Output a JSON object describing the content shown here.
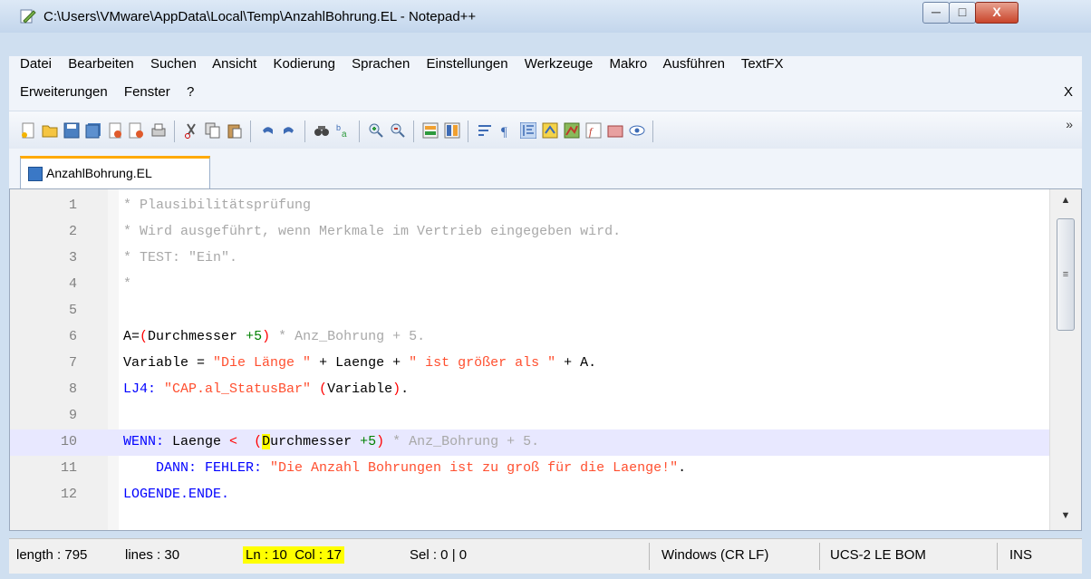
{
  "window": {
    "title": "C:\\Users\\VMware\\AppData\\Local\\Temp\\AnzahlBohrung.EL - Notepad++",
    "minimize_glyph": "─",
    "maximize_glyph": "□",
    "close_glyph": "X"
  },
  "menu": {
    "row1": [
      "Datei",
      "Bearbeiten",
      "Suchen",
      "Ansicht",
      "Kodierung",
      "Sprachen",
      "Einstellungen",
      "Werkzeuge",
      "Makro",
      "Ausführen",
      "TextFX"
    ],
    "row2": [
      "Erweiterungen",
      "Fenster",
      "?"
    ],
    "close_doc": "X"
  },
  "toolbar": {
    "more_glyph": "»"
  },
  "tabs": [
    {
      "label": "AnzahlBohrung.EL",
      "active": true
    }
  ],
  "editor": {
    "current_line": 10,
    "lines": [
      {
        "n": "1",
        "segs": [
          {
            "t": "* Plausibilitätsprüfung",
            "c": "comment"
          }
        ]
      },
      {
        "n": "2",
        "segs": [
          {
            "t": "* Wird ausgeführt, wenn Merkmale im Vertrieb eingegeben wird.",
            "c": "comment"
          }
        ]
      },
      {
        "n": "3",
        "segs": [
          {
            "t": "* TEST: \"Ein\".",
            "c": "comment"
          }
        ]
      },
      {
        "n": "4",
        "segs": [
          {
            "t": "*",
            "c": "comment"
          }
        ]
      },
      {
        "n": "5",
        "segs": []
      },
      {
        "n": "6",
        "segs": [
          {
            "t": "A=",
            "c": ""
          },
          {
            "t": "(",
            "c": "brace"
          },
          {
            "t": "Durchmesser ",
            "c": ""
          },
          {
            "t": "+5",
            "c": "num"
          },
          {
            "t": ")",
            "c": "brace"
          },
          {
            "t": " * Anz_Bohrung + 5.",
            "c": "comment"
          }
        ]
      },
      {
        "n": "7",
        "segs": [
          {
            "t": "Variable = ",
            "c": ""
          },
          {
            "t": "\"Die Länge \"",
            "c": "str"
          },
          {
            "t": " + Laenge + ",
            "c": ""
          },
          {
            "t": "\" ist größer als \"",
            "c": "str"
          },
          {
            "t": " + A.",
            "c": ""
          }
        ]
      },
      {
        "n": "8",
        "segs": [
          {
            "t": "LJ4: ",
            "c": "kw"
          },
          {
            "t": "\"CAP.al_StatusBar\"",
            "c": "str"
          },
          {
            "t": " (",
            "c": "brace"
          },
          {
            "t": "Variable",
            "c": ""
          },
          {
            "t": ")",
            "c": "brace"
          },
          {
            "t": ".",
            "c": ""
          }
        ]
      },
      {
        "n": "9",
        "segs": []
      },
      {
        "n": "10",
        "segs": [
          {
            "t": "WENN: ",
            "c": "kw"
          },
          {
            "t": "Laenge ",
            "c": ""
          },
          {
            "t": "< ",
            "c": "brace"
          },
          {
            "t": " ",
            "c": ""
          },
          {
            "t": "(",
            "c": "brace"
          },
          {
            "t": "D",
            "c": "hl"
          },
          {
            "t": "urchmesser ",
            "c": ""
          },
          {
            "t": "+5",
            "c": "num"
          },
          {
            "t": ")",
            "c": "brace"
          },
          {
            "t": " * Anz_Bohrung + 5.",
            "c": "comment"
          }
        ]
      },
      {
        "n": "11",
        "segs": [
          {
            "t": "    DANN: FEHLER: ",
            "c": "kw"
          },
          {
            "t": "\"Die Anzahl Bohrungen ist zu groß für die Laenge!\"",
            "c": "str"
          },
          {
            "t": ".",
            "c": ""
          }
        ]
      },
      {
        "n": "12",
        "segs": [
          {
            "t": "LOGENDE.ENDE.",
            "c": "kw"
          }
        ]
      }
    ]
  },
  "scrollbar": {
    "up_glyph": "▲",
    "down_glyph": "▼",
    "grip_glyph": "≡"
  },
  "status": {
    "length": "length : 795",
    "lines": "lines : 30",
    "ln": "Ln : 10",
    "col": "Col : 17",
    "sel": "Sel : 0 | 0",
    "eol": "Windows (CR LF)",
    "encoding": "UCS-2 LE BOM",
    "mode": "INS"
  },
  "colors": {
    "comment": "#a8a8a8",
    "keyword": "#0000ff",
    "string": "#ff4f2f",
    "number": "#008000",
    "operator": "#ff0000",
    "current_line": "#e8e8ff",
    "highlight": "#ffff00"
  }
}
